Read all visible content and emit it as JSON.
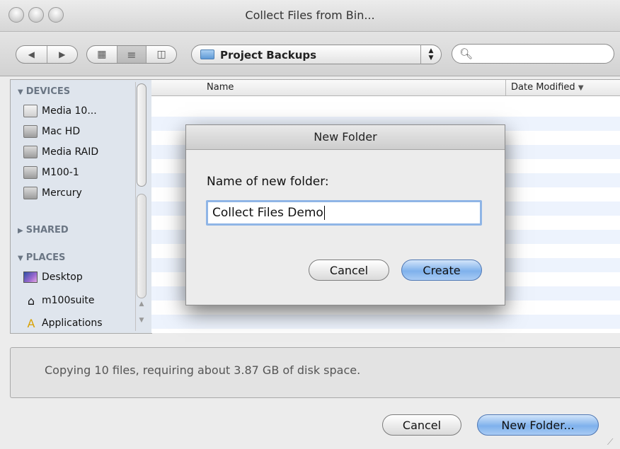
{
  "window": {
    "title": "Collect Files from Bin..."
  },
  "toolbar": {
    "back_icon": "◀",
    "forward_icon": "▶",
    "view_icons": "▦",
    "view_list": "≡",
    "view_columns": "◫",
    "location": "Project Backups",
    "search_placeholder": ""
  },
  "sidebar": {
    "devices": {
      "label": "DEVICES",
      "items": [
        "Media 10...",
        "Mac HD",
        "Media RAID",
        "M100-1",
        "Mercury"
      ]
    },
    "shared": {
      "label": "SHARED"
    },
    "places": {
      "label": "PLACES",
      "items": [
        "Desktop",
        "m100suite",
        "Applications"
      ]
    }
  },
  "list": {
    "col_name": "Name",
    "col_date": "Date Modified",
    "sort_indicator": "▼"
  },
  "status": {
    "text": "Copying 10 files, requiring about 3.87 GB of disk space."
  },
  "buttons": {
    "cancel": "Cancel",
    "new_folder": "New Folder..."
  },
  "sheet": {
    "title": "New Folder",
    "prompt": "Name of new folder:",
    "value": "Collect Files Demo",
    "cancel": "Cancel",
    "create": "Create"
  },
  "colors": {
    "default_button": "#7fb1ec",
    "sidebar_bg": "#dfe5ed",
    "row_stripe": "#edf3fd"
  }
}
